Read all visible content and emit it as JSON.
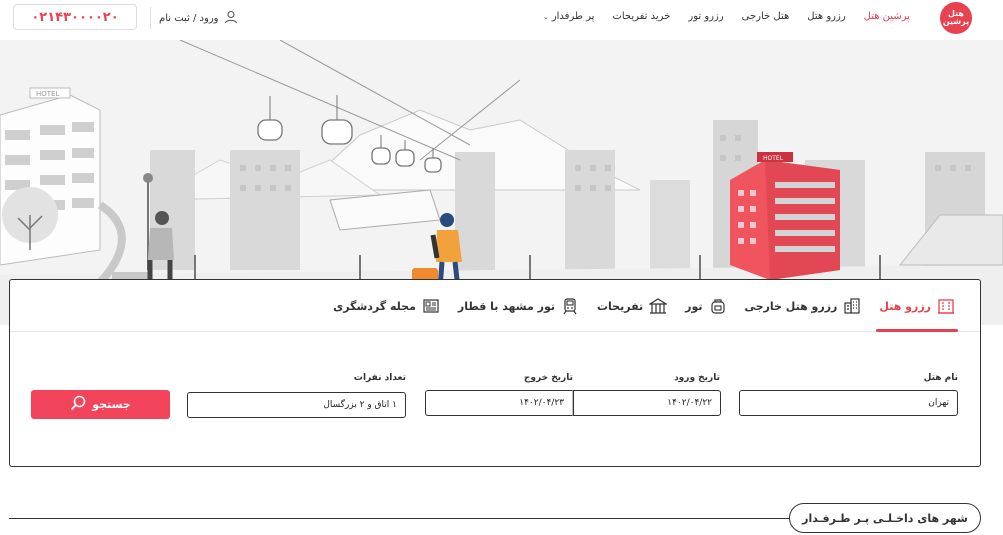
{
  "header": {
    "logo_text": "هتل پرشین",
    "nav": [
      {
        "label": "پرشین هتل",
        "active": true
      },
      {
        "label": "رزرو هتل",
        "active": false
      },
      {
        "label": "هتل خارجی",
        "active": false
      },
      {
        "label": "رزرو تور",
        "active": false
      },
      {
        "label": "خرید تفریحات",
        "active": false
      },
      {
        "label": "پر طرفدار",
        "active": false,
        "dropdown": true
      }
    ],
    "login_label": "ورود / ثبت نام",
    "phone": "۰۲۱۴۳۰۰۰۰۲۰",
    "accent_color": "#e8414f"
  },
  "hero": {
    "hotel_sign": "HOTEL"
  },
  "search": {
    "tabs": [
      {
        "label": "رزرو هتل",
        "icon": "hotel-icon",
        "active": true
      },
      {
        "label": "رزرو هتل خارجی",
        "icon": "building-icon",
        "active": false
      },
      {
        "label": "تور",
        "icon": "backpack-icon",
        "active": false
      },
      {
        "label": "تفریحات",
        "icon": "pavilion-icon",
        "active": false
      },
      {
        "label": "تور مشهد با قطار",
        "icon": "train-icon",
        "active": false
      },
      {
        "label": "مجله گردشگری",
        "icon": "newspaper-icon",
        "active": false
      }
    ],
    "hotel_name_label": "نام هتل",
    "hotel_name_value": "تهران",
    "checkin_label": "تاریخ ورود",
    "checkin_value": "۱۴۰۲/۰۴/۲۲",
    "checkout_label": "تاریخ خروج",
    "checkout_value": "۱۴۰۲/۰۴/۲۳",
    "guests_label": "تعداد نفرات",
    "guests_value": "۱ اتاق و ۲ بزرگسال",
    "search_button": "جستجو"
  },
  "section": {
    "title": "شهر های داخـلـی پـر طـرفـدار"
  }
}
